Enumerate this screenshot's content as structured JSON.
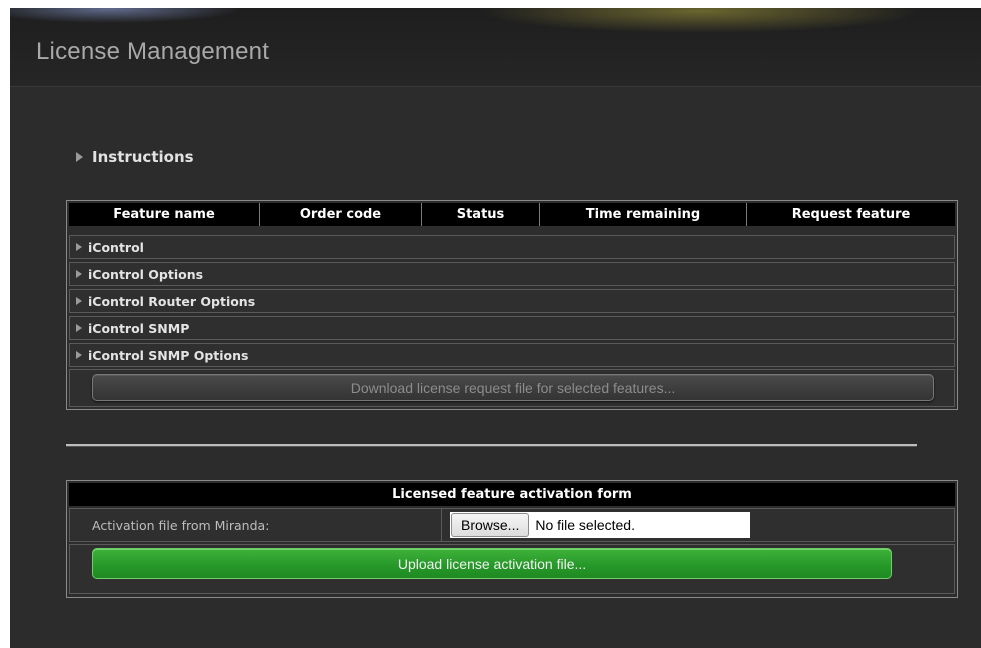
{
  "page": {
    "title": "License Management",
    "instructions_label": "Instructions"
  },
  "features_table": {
    "columns": [
      "Feature name",
      "Order code",
      "Status",
      "Time remaining",
      "Request feature"
    ],
    "rows": [
      "iControl",
      "iControl Options",
      "iControl Router Options",
      "iControl SNMP",
      "iControl SNMP Options"
    ],
    "download_button": "Download license request file for selected features..."
  },
  "activation_form": {
    "title": "Licensed feature activation form",
    "file_label": "Activation file from Miranda:",
    "browse_button": "Browse...",
    "file_status": "No file selected.",
    "upload_button": "Upload license activation file..."
  },
  "colors": {
    "panel_bg": "#2c2c2c",
    "header_bg": "#000000",
    "upload_green": "#27992a"
  }
}
